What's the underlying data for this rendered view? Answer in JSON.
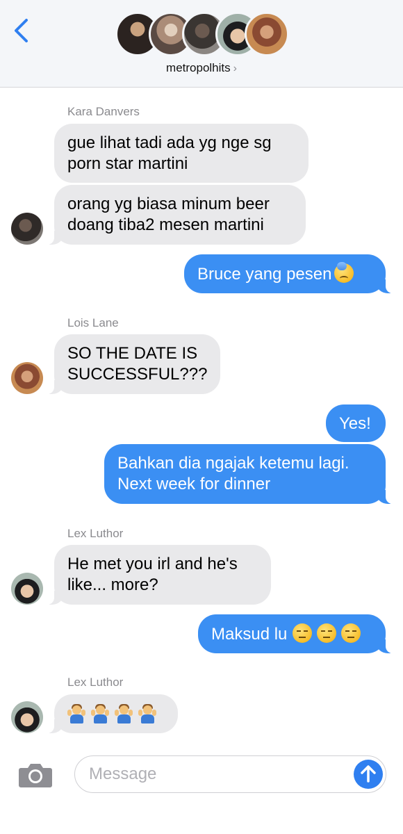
{
  "header": {
    "group_name": "metropolhits",
    "chevron": "›"
  },
  "messages": [
    {
      "sender": "Kara Danvers",
      "text": "gue lihat tadi ada yg nge sg\nporn star martini"
    },
    {
      "text": "orang yg biasa minum beer\ndoang tiba2 mesen martini"
    },
    {
      "text": "Bruce yang pesen",
      "emoji": "downcast-face-with-sweat"
    },
    {
      "sender": "Lois Lane",
      "text": "SO THE DATE IS\nSUCCESSFUL???"
    },
    {
      "text": "Yes!"
    },
    {
      "text": "Bahkan dia ngajak ketemu lagi.\nNext week for dinner"
    },
    {
      "sender": "Lex Luthor",
      "text": "He met you irl and he's\nlike... more?"
    },
    {
      "text": "Maksud lu",
      "emoji": "expressionless-face x3"
    },
    {
      "sender": "Lex Luthor",
      "emoji": "man-shrugging x4"
    }
  ],
  "input": {
    "placeholder": "Message"
  },
  "colors": {
    "sent_bubble": "#3b8ff3",
    "received_bubble": "#e9e9eb",
    "accent": "#2f7ff0"
  },
  "icons": [
    "back-chevron-icon",
    "camera-icon",
    "send-arrow-icon"
  ]
}
